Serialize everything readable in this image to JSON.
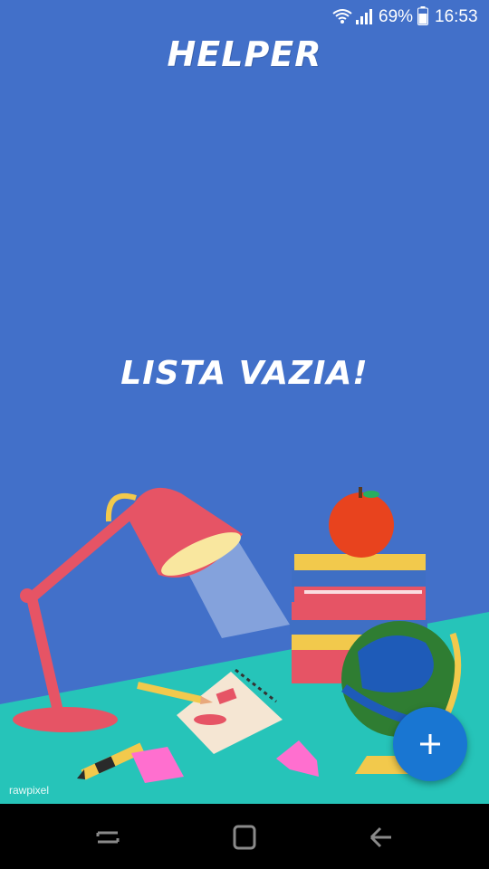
{
  "status_bar": {
    "battery_percent": "69%",
    "time": "16:53",
    "icons": [
      "wifi-icon",
      "signal-icon",
      "battery-icon"
    ]
  },
  "app": {
    "title": "HELPER",
    "empty_message": "LISTA VAZIA!"
  },
  "illustration": {
    "watermark": "rawpixel"
  },
  "fab": {
    "icon": "plus-icon",
    "color": "#1976d2"
  },
  "nav_bar": {
    "buttons": [
      "recent-apps-icon",
      "home-icon",
      "back-icon"
    ]
  },
  "colors": {
    "background": "#4270c9",
    "desk": "#26c4b9",
    "nav_bar": "#000000"
  }
}
